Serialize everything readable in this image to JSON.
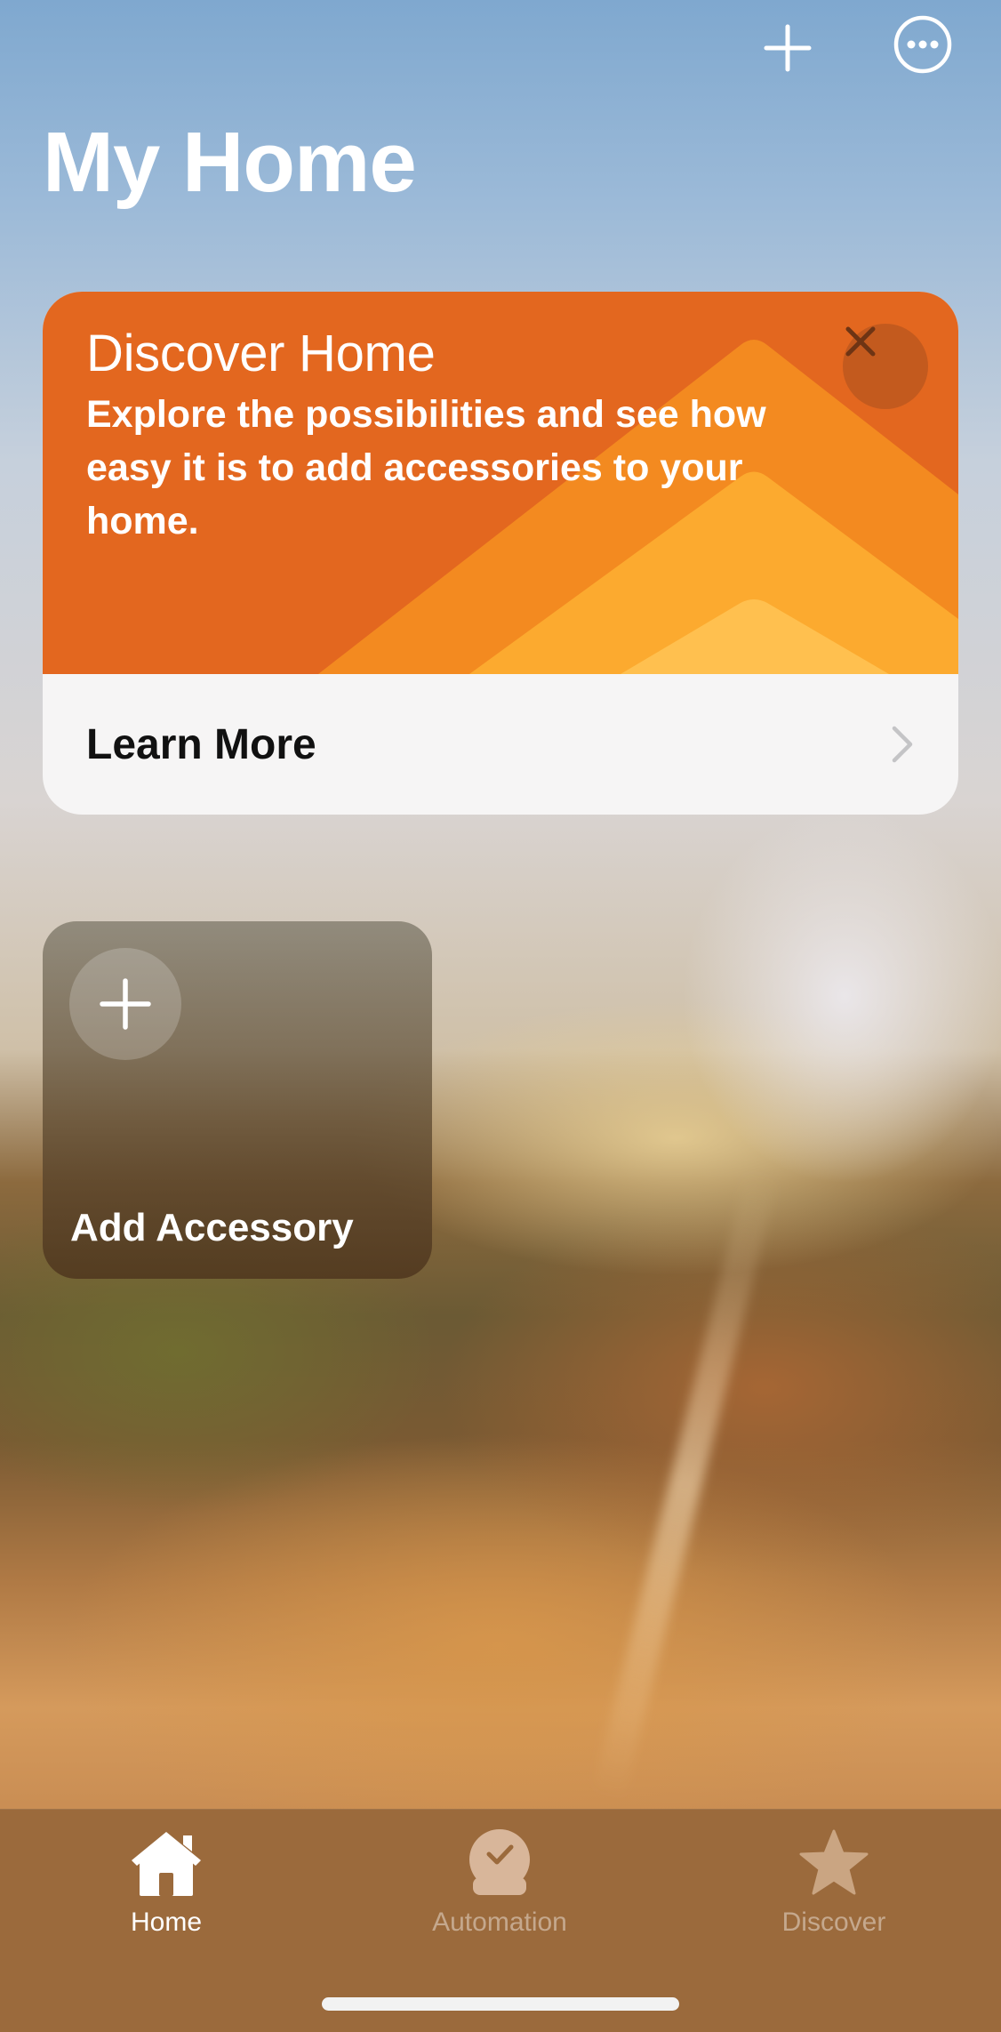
{
  "header": {
    "add_icon": "plus-icon",
    "more_icon": "ellipsis-circle-icon",
    "title": "My Home"
  },
  "discover_card": {
    "heading": "Discover Home",
    "body": "Explore the possibilities and see how easy it is to add accessories to your home.",
    "close_icon": "close-icon",
    "action_label": "Learn More",
    "action_icon": "chevron-right-icon",
    "accent_color": "#e3671f"
  },
  "add_accessory": {
    "label": "Add Accessory",
    "icon": "plus-icon"
  },
  "tabbar": {
    "tabs": [
      {
        "label": "Home",
        "icon": "house-icon",
        "active": true
      },
      {
        "label": "Automation",
        "icon": "clock-check-icon",
        "active": false
      },
      {
        "label": "Discover",
        "icon": "star-icon",
        "active": false
      }
    ]
  }
}
